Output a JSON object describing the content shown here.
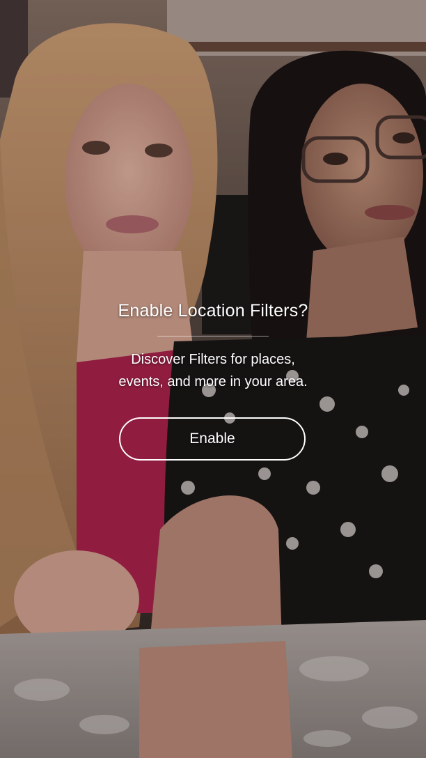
{
  "prompt": {
    "title": "Enable Location Filters?",
    "description_line1": "Discover Filters for places,",
    "description_line2": "events, and more in your area.",
    "enable_label": "Enable"
  },
  "colors": {
    "overlay_text": "#ffffff",
    "button_border": "#ffffff"
  }
}
